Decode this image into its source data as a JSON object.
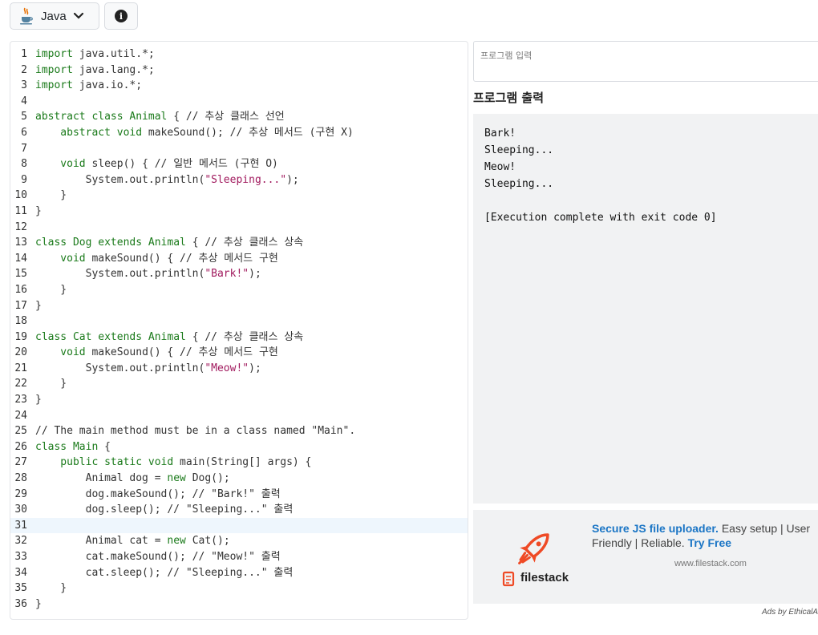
{
  "toolbar": {
    "language_label": "Java",
    "language_icon": "java-cup-icon",
    "info_icon": "info-icon"
  },
  "editor": {
    "active_line": 31,
    "lines": [
      [
        {
          "t": "import ",
          "c": "kw"
        },
        {
          "t": "java.util.*;",
          "c": ""
        }
      ],
      [
        {
          "t": "import ",
          "c": "kw"
        },
        {
          "t": "java.lang.*;",
          "c": ""
        }
      ],
      [
        {
          "t": "import ",
          "c": "kw"
        },
        {
          "t": "java.io.*;",
          "c": ""
        }
      ],
      [],
      [
        {
          "t": "abstract class ",
          "c": "kw"
        },
        {
          "t": "Animal",
          "c": "ty"
        },
        {
          "t": " { // 추상 클래스 선언",
          "c": ""
        }
      ],
      [
        {
          "t": "    abstract void ",
          "c": "kw"
        },
        {
          "t": "makeSound(); // 추상 메서드 (구현 X)",
          "c": ""
        }
      ],
      [],
      [
        {
          "t": "    void ",
          "c": "kw"
        },
        {
          "t": "sleep() { // 일반 메서드 (구현 O)",
          "c": ""
        }
      ],
      [
        {
          "t": "        System.out.println(",
          "c": ""
        },
        {
          "t": "\"Sleeping...\"",
          "c": "str"
        },
        {
          "t": ");",
          "c": ""
        }
      ],
      [
        {
          "t": "    }",
          "c": ""
        }
      ],
      [
        {
          "t": "}",
          "c": ""
        }
      ],
      [],
      [
        {
          "t": "class ",
          "c": "kw"
        },
        {
          "t": "Dog ",
          "c": "ty"
        },
        {
          "t": "extends ",
          "c": "kw"
        },
        {
          "t": "Animal",
          "c": "ty"
        },
        {
          "t": " { // 추상 클래스 상속",
          "c": ""
        }
      ],
      [
        {
          "t": "    void ",
          "c": "kw"
        },
        {
          "t": "makeSound() { // 추상 메서드 구현",
          "c": ""
        }
      ],
      [
        {
          "t": "        System.out.println(",
          "c": ""
        },
        {
          "t": "\"Bark!\"",
          "c": "str"
        },
        {
          "t": ");",
          "c": ""
        }
      ],
      [
        {
          "t": "    }",
          "c": ""
        }
      ],
      [
        {
          "t": "}",
          "c": ""
        }
      ],
      [],
      [
        {
          "t": "class ",
          "c": "kw"
        },
        {
          "t": "Cat ",
          "c": "ty"
        },
        {
          "t": "extends ",
          "c": "kw"
        },
        {
          "t": "Animal",
          "c": "ty"
        },
        {
          "t": " { // 추상 클래스 상속",
          "c": ""
        }
      ],
      [
        {
          "t": "    void ",
          "c": "kw"
        },
        {
          "t": "makeSound() { // 추상 메서드 구현",
          "c": ""
        }
      ],
      [
        {
          "t": "        System.out.println(",
          "c": ""
        },
        {
          "t": "\"Meow!\"",
          "c": "str"
        },
        {
          "t": ");",
          "c": ""
        }
      ],
      [
        {
          "t": "    }",
          "c": ""
        }
      ],
      [
        {
          "t": "}",
          "c": ""
        }
      ],
      [],
      [
        {
          "t": "// The main method must be in a class named \"Main\".",
          "c": "cm"
        }
      ],
      [
        {
          "t": "class ",
          "c": "kw"
        },
        {
          "t": "Main",
          "c": "ty"
        },
        {
          "t": " {",
          "c": ""
        }
      ],
      [
        {
          "t": "    public static void ",
          "c": "kw"
        },
        {
          "t": "main(String[] args) {",
          "c": ""
        }
      ],
      [
        {
          "t": "        Animal dog = ",
          "c": ""
        },
        {
          "t": "new ",
          "c": "kw"
        },
        {
          "t": "Dog();",
          "c": ""
        }
      ],
      [
        {
          "t": "        dog.makeSound(); // \"Bark!\" 출력",
          "c": ""
        }
      ],
      [
        {
          "t": "        dog.sleep(); // \"Sleeping...\" 출력",
          "c": ""
        }
      ],
      [],
      [
        {
          "t": "        Animal cat = ",
          "c": ""
        },
        {
          "t": "new ",
          "c": "kw"
        },
        {
          "t": "Cat();",
          "c": ""
        }
      ],
      [
        {
          "t": "        cat.makeSound(); // \"Meow!\" 출력",
          "c": ""
        }
      ],
      [
        {
          "t": "        cat.sleep(); // \"Sleeping...\" 출력",
          "c": ""
        }
      ],
      [
        {
          "t": "    }",
          "c": ""
        }
      ],
      [
        {
          "t": "}",
          "c": ""
        }
      ]
    ]
  },
  "input": {
    "placeholder": "프로그램 입력",
    "value": ""
  },
  "output": {
    "heading": "프로그램 출력",
    "lines": [
      "Bark!",
      "Sleeping...",
      "Meow!",
      "Sleeping...",
      "",
      "[Execution complete with exit code 0]"
    ]
  },
  "ad": {
    "headline": "Secure JS file uploader.",
    "body": " Easy setup | User Friendly | Reliable. ",
    "cta": "Try Free",
    "url": "www.filestack.com",
    "brand": "filestack",
    "brand_color": "#ef4a25",
    "ads_by": "Ads by EthicalAds"
  }
}
